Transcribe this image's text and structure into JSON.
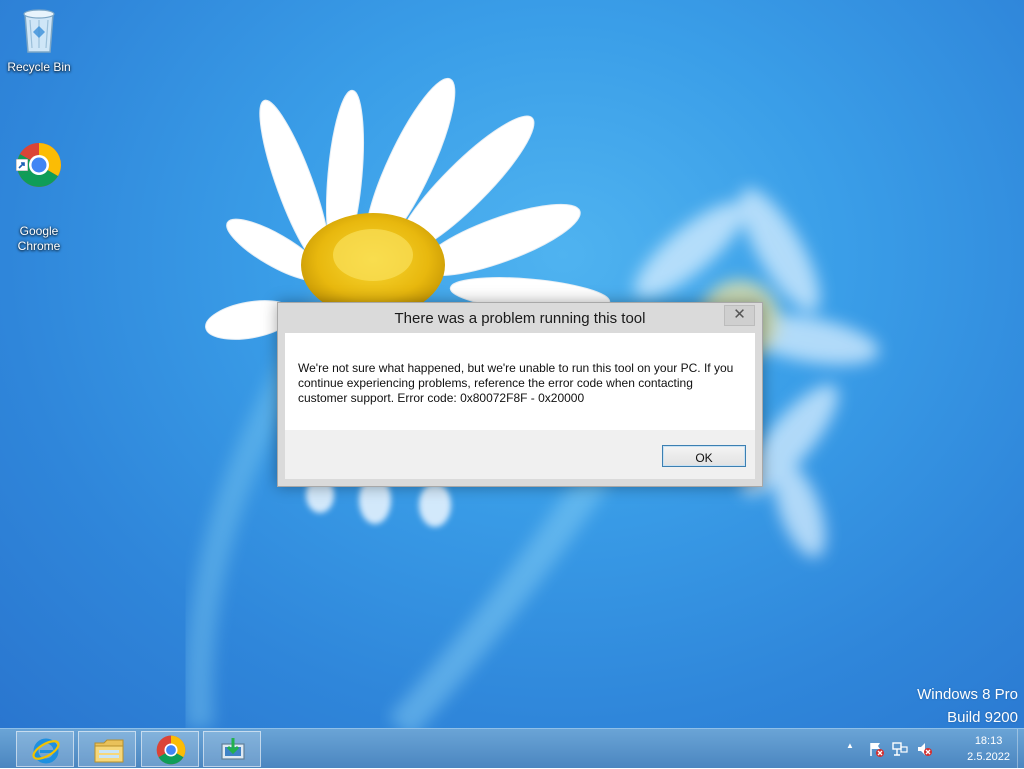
{
  "desktop": {
    "icons": [
      {
        "label": "Recycle Bin",
        "icon": "recycle-bin-icon"
      },
      {
        "label": "Google\nChrome",
        "icon": "chrome-icon"
      }
    ],
    "watermark": {
      "line1": "Windows 8 Pro",
      "line2": "Build 9200"
    }
  },
  "dialog": {
    "title": "There was a problem running this tool",
    "close_glyph": "✕",
    "message": "We're not sure what happened, but we're unable to run this tool on your PC. If you continue experiencing problems, reference the error code when contacting customer support. Error code: 0x80072F8F - 0x20000",
    "ok_label": "OK"
  },
  "taskbar": {
    "buttons": [
      {
        "name": "internet-explorer",
        "icon": "internet-explorer-icon"
      },
      {
        "name": "file-explorer",
        "icon": "folder-icon"
      },
      {
        "name": "google-chrome",
        "icon": "chrome-icon"
      },
      {
        "name": "media-creation-tool",
        "icon": "download-tool-icon"
      }
    ],
    "tray": {
      "show_hidden_glyph": "▲",
      "clock_time": "18:13",
      "clock_date": "2.5.2022"
    }
  },
  "colors": {
    "accent_blue": "#3a9ee8",
    "taskbar": "#4b86c0",
    "ok_border": "#3c7fb1"
  }
}
